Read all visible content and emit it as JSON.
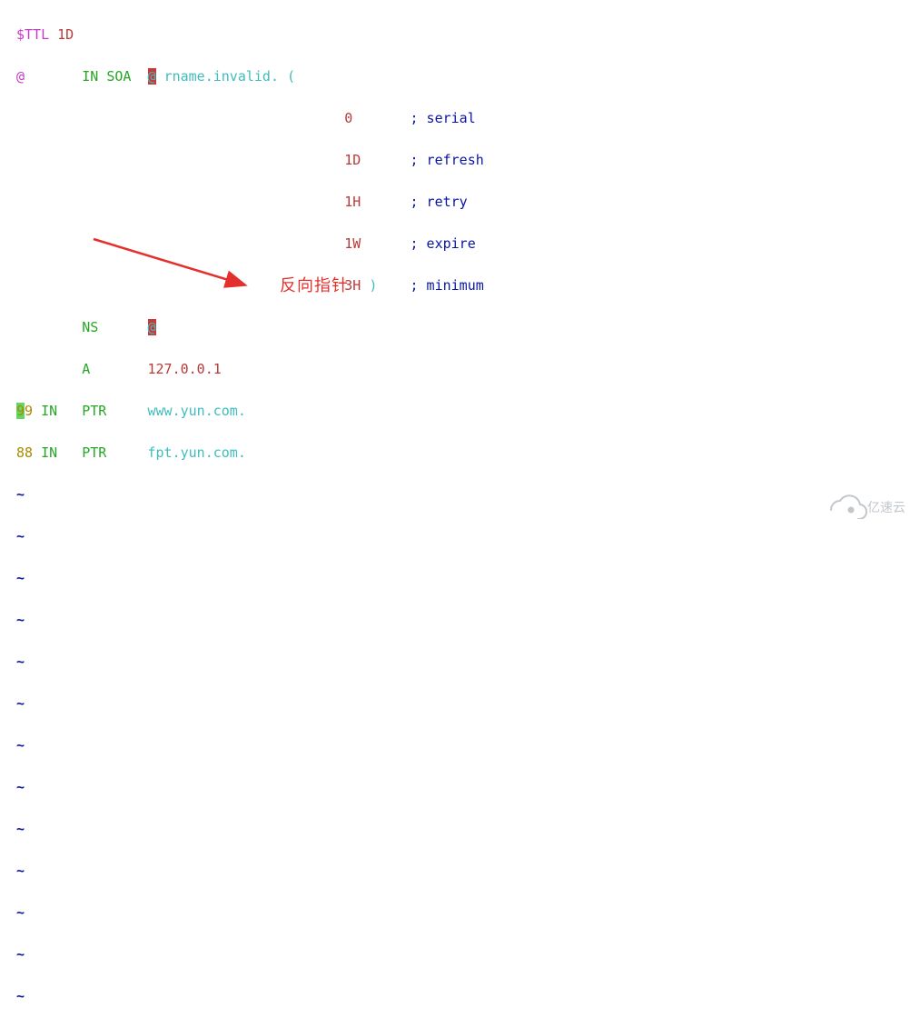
{
  "ttl": {
    "directive": "$TTL",
    "value": "1D"
  },
  "soa": {
    "origin": "@",
    "class": "IN",
    "type": "SOA",
    "mname": "@",
    "rname_paren": "rname.invalid. (",
    "serial": {
      "val": "0",
      "comment": "; serial"
    },
    "refresh": {
      "val": "1D",
      "comment": "; refresh"
    },
    "retry": {
      "val": "1H",
      "comment": "; retry"
    },
    "expire": {
      "val": "1W",
      "comment": "; expire"
    },
    "minimum": {
      "val": "3H",
      "close": ")",
      "comment": "; minimum"
    }
  },
  "ns": {
    "type": "NS",
    "value": "@"
  },
  "a": {
    "type": "A",
    "value": "127.0.0.1"
  },
  "ptr1": {
    "first": "9",
    "rest": "9",
    "class": "IN",
    "type": "PTR",
    "value": "www.yun.com."
  },
  "ptr2": {
    "name": "88",
    "class": "IN",
    "type": "PTR",
    "value": "fpt.yun.com."
  },
  "annotation": {
    "label": "反向指针",
    "arrowColor": "#e4302c"
  },
  "tilde": "~",
  "watermark": {
    "text": "亿速云"
  }
}
